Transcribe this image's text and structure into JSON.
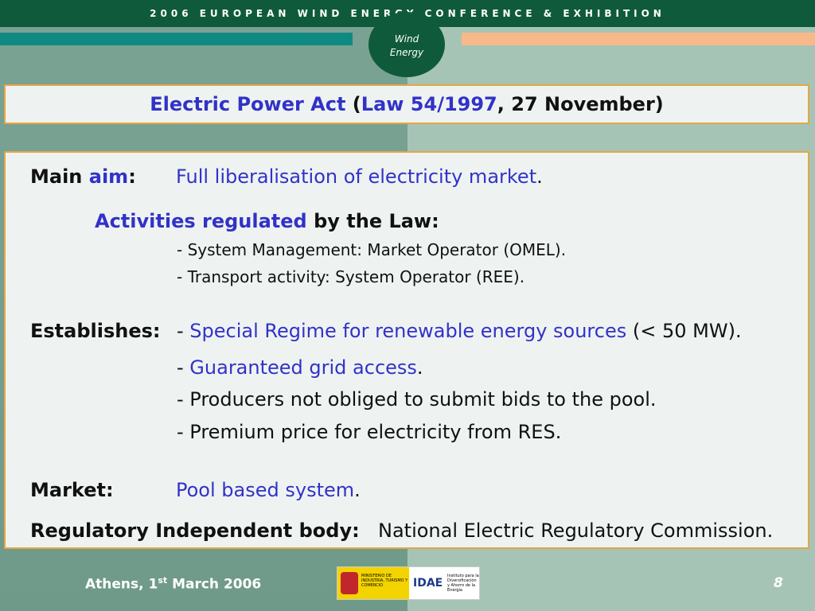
{
  "header": {
    "conference": "2006 EUROPEAN WIND ENERGY CONFERENCE & EXHIBITION",
    "logo_line1": "Wind",
    "logo_line2": "Energy"
  },
  "title": {
    "part1": "Electric Power Act",
    "open_paren": " (",
    "law": "Law 54/1997",
    "rest": ", 27 November)"
  },
  "content": {
    "main_label": "Main ",
    "main_aim": "aim",
    "main_colon": ":",
    "main_value": "Full liberalisation of electricity market",
    "main_period": ".",
    "activities_blue": "Activities regulated",
    "activities_rest": " by the Law:",
    "activity1": "- System Management: Market Operator (OMEL).",
    "activity2": "- Transport activity: System Operator (REE).",
    "establishes_label": "Establishes:",
    "est1_dash": "- ",
    "est1_blue": "Special Regime for renewable energy sources",
    "est1_rest": " (< 50 MW).",
    "est2_dash": "- ",
    "est2_blue": "Guaranteed grid access",
    "est2_rest": ".",
    "est3": "- Producers not obliged to submit bids to the pool.",
    "est4": "- Premium price for electricity from RES.",
    "market_label": "Market:",
    "market_blue": "Pool based system",
    "market_rest": ".",
    "regulatory_label": "Regulatory Independent body:",
    "regulatory_value": "National Electric Regulatory Commission."
  },
  "footer": {
    "location_prefix": "Athens, 1",
    "location_sup": "st",
    "location_suffix": " March 2006",
    "page_number": "8",
    "ministry_text": "MINISTERIO DE INDUSTRIA, TURISMO Y COMERCIO",
    "idae_mark": "IDAE",
    "idae_text": "Instituto para la Diversificación y Ahorro de la Energía"
  },
  "colors": {
    "accent_blue": "#3232c8",
    "header_green": "#0f5a3a",
    "border_orange": "#e7a545"
  }
}
